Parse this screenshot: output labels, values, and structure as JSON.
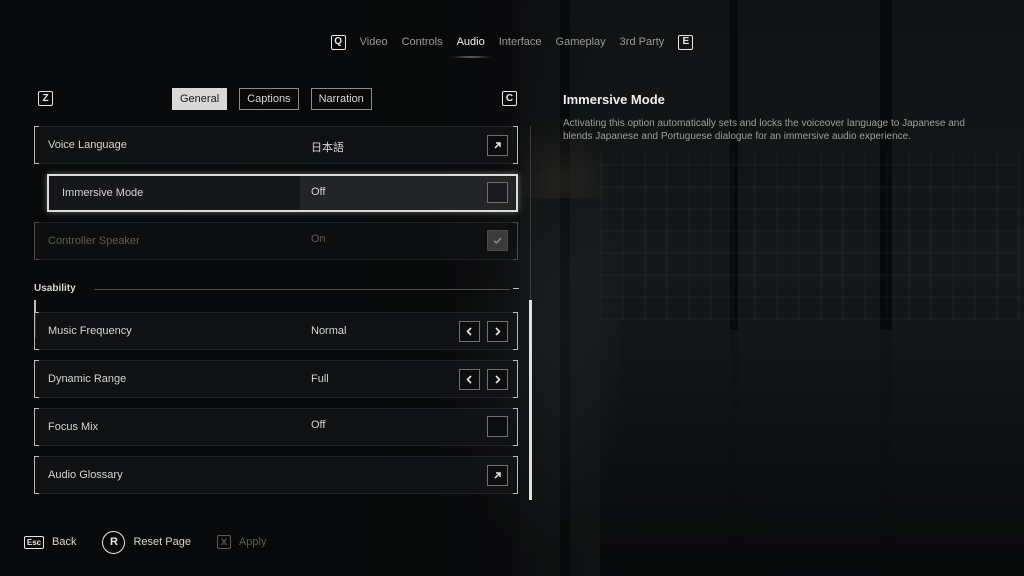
{
  "nav": {
    "left_key": "Q",
    "right_key": "E",
    "tabs": [
      "Video",
      "Controls",
      "Audio",
      "Interface",
      "Gameplay",
      "3rd Party"
    ],
    "active_tab": "Audio"
  },
  "subtabs": {
    "left_key": "Z",
    "right_key": "C",
    "items": [
      "General",
      "Captions",
      "Narration"
    ],
    "active": "General"
  },
  "settings": {
    "voice_language": {
      "label": "Voice Language",
      "value": "日本語",
      "icon": "external-link-icon"
    },
    "immersive_mode": {
      "label": "Immersive Mode",
      "value": "Off",
      "checked": false
    },
    "controller_speaker": {
      "label": "Controller Speaker",
      "value": "On",
      "checked": true,
      "disabled": true
    },
    "section_usability": "Usability",
    "music_frequency": {
      "label": "Music Frequency",
      "value": "Normal"
    },
    "dynamic_range": {
      "label": "Dynamic Range",
      "value": "Full"
    },
    "focus_mix": {
      "label": "Focus Mix",
      "value": "Off",
      "checked": false
    },
    "audio_glossary": {
      "label": "Audio Glossary",
      "icon": "external-link-icon"
    }
  },
  "description": {
    "title": "Immersive Mode",
    "body": "Activating this option automatically sets and locks the voiceover language to Japanese and blends Japanese and Portuguese dialogue for an immersive audio experience."
  },
  "footer": {
    "back": {
      "key": "Esc",
      "label": "Back"
    },
    "reset": {
      "key": "R",
      "label": "Reset Page"
    },
    "apply": {
      "key": "X",
      "label": "Apply",
      "disabled": true
    }
  },
  "colors": {
    "accent": "#dcdcdc",
    "background": "#0b0c0d",
    "disabled_text": "#5b5b5b"
  }
}
